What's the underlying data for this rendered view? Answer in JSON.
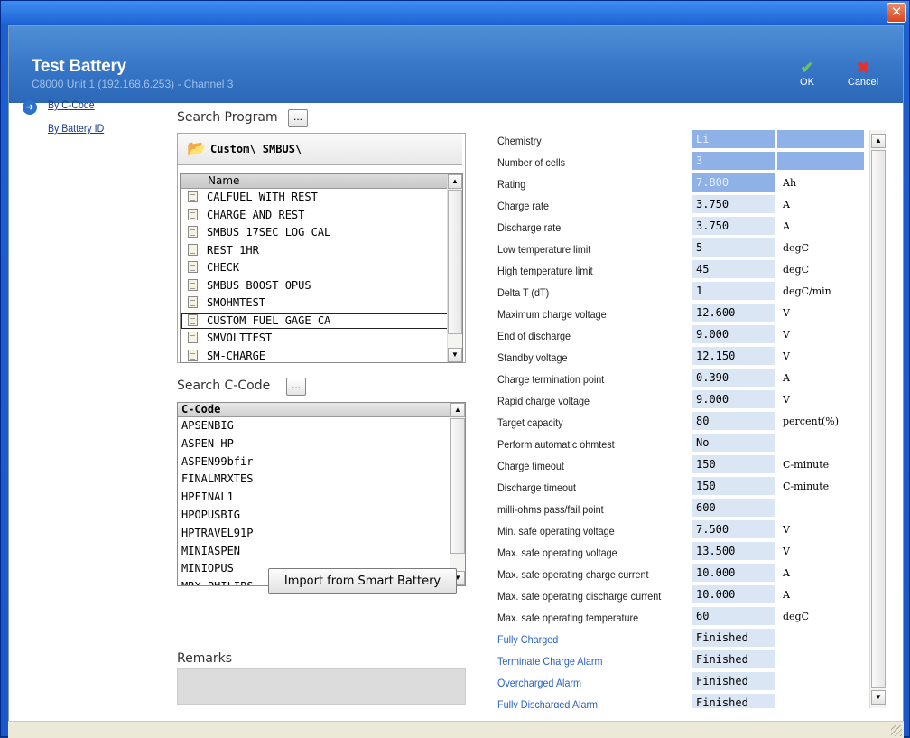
{
  "window": {
    "close_glyph": "✕"
  },
  "header": {
    "title": "Test Battery",
    "subtitle": "C8000 Unit 1 (192.168.6.253) - Channel 3",
    "ok_label": "OK",
    "cancel_label": "Cancel"
  },
  "nav": {
    "items": [
      {
        "label": "By C-Code"
      },
      {
        "label": "By Battery ID"
      }
    ]
  },
  "program": {
    "search_label": "Search Program",
    "dots": "...",
    "folder_path": "Custom\\ SMBUS\\",
    "column_header": "Name",
    "items": [
      "CALFUEL WITH REST",
      "CHARGE AND REST",
      "SMBUS 17SEC LOG CAL",
      "REST 1HR",
      "CHECK",
      "SMBUS BOOST OPUS",
      "SMOHMTEST",
      "CUSTOM FUEL GAGE CA",
      "SMVOLTTEST",
      "SM-CHARGE"
    ],
    "selected_index": 7
  },
  "ccode": {
    "search_label": "Search C-Code",
    "dots": "...",
    "column_header": "C-Code",
    "items": [
      "APSENBIG",
      "ASPEN HP",
      "ASPEN99bfir",
      "FINALMRXTES",
      "HPFINAL1",
      "HPOPUSBIG",
      "HPTRAVEL91P",
      "MINIASPEN",
      "MINIOPUS",
      "MRX PHILIPS"
    ]
  },
  "import_button": "Import from Smart Battery",
  "remarks_label": "Remarks",
  "properties": [
    {
      "name": "Chemistry",
      "value": "Li",
      "unit": "",
      "disabled": true,
      "unit_filled": true
    },
    {
      "name": "Number of cells",
      "value": "3",
      "unit": "",
      "disabled": true,
      "unit_filled": true
    },
    {
      "name": "Rating",
      "value": "7.800",
      "unit": "Ah",
      "disabled": true,
      "unit_filled": false
    },
    {
      "name": "Charge rate",
      "value": "3.750",
      "unit": "A"
    },
    {
      "name": "Discharge rate",
      "value": "3.750",
      "unit": "A"
    },
    {
      "name": "Low temperature limit",
      "value": "5",
      "unit": "degC"
    },
    {
      "name": "High temperature limit",
      "value": "45",
      "unit": "degC"
    },
    {
      "name": "Delta T (dT)",
      "value": "1",
      "unit": "degC/min"
    },
    {
      "name": "Maximum charge voltage",
      "value": "12.600",
      "unit": "V"
    },
    {
      "name": "End of discharge",
      "value": "9.000",
      "unit": "V"
    },
    {
      "name": "Standby voltage",
      "value": "12.150",
      "unit": "V"
    },
    {
      "name": "Charge termination point",
      "value": "0.390",
      "unit": "A"
    },
    {
      "name": "Rapid charge voltage",
      "value": "9.000",
      "unit": "V"
    },
    {
      "name": "Target capacity",
      "value": "80",
      "unit": "percent(%)"
    },
    {
      "name": "Perform automatic ohmtest",
      "value": "No",
      "unit": ""
    },
    {
      "name": "Charge timeout",
      "value": "150",
      "unit": "C-minute"
    },
    {
      "name": "Discharge timeout",
      "value": "150",
      "unit": "C-minute"
    },
    {
      "name": "milli-ohms pass/fail point",
      "value": "600",
      "unit": ""
    },
    {
      "name": "Min. safe operating voltage",
      "value": "7.500",
      "unit": "V"
    },
    {
      "name": "Max. safe operating voltage",
      "value": "13.500",
      "unit": "V"
    },
    {
      "name": "Max. safe operating charge current",
      "value": "10.000",
      "unit": "A"
    },
    {
      "name": "Max. safe operating discharge current",
      "value": "10.000",
      "unit": "A"
    },
    {
      "name": "Max. safe operating temperature",
      "value": "60",
      "unit": "degC"
    },
    {
      "name": "Fully Charged",
      "value": "Finished",
      "unit": "",
      "blue": true
    },
    {
      "name": "Terminate Charge Alarm",
      "value": "Finished",
      "unit": "",
      "blue": true
    },
    {
      "name": "Overcharged Alarm",
      "value": "Finished",
      "unit": "",
      "blue": true
    },
    {
      "name": "Fully Discharged Alarm",
      "value": "Finished",
      "unit": "",
      "blue": true
    }
  ]
}
